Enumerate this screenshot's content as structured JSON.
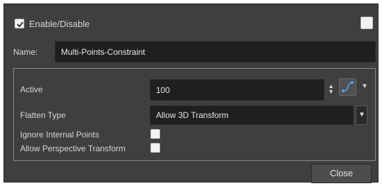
{
  "dialog": {
    "enable": {
      "label": "Enable/Disable",
      "checked": true
    },
    "name": {
      "label": "Name:",
      "value": "Multi-Points-Constraint"
    },
    "active": {
      "label": "Active",
      "value": "100"
    },
    "flatten": {
      "label": "Flatten Type",
      "value": "Allow 3D Transform"
    },
    "ignore_internal": {
      "label": "Ignore Internal Points",
      "checked": false
    },
    "allow_perspective": {
      "label": "Allow Perspective Transform",
      "checked": false
    },
    "close_label": "Close"
  }
}
